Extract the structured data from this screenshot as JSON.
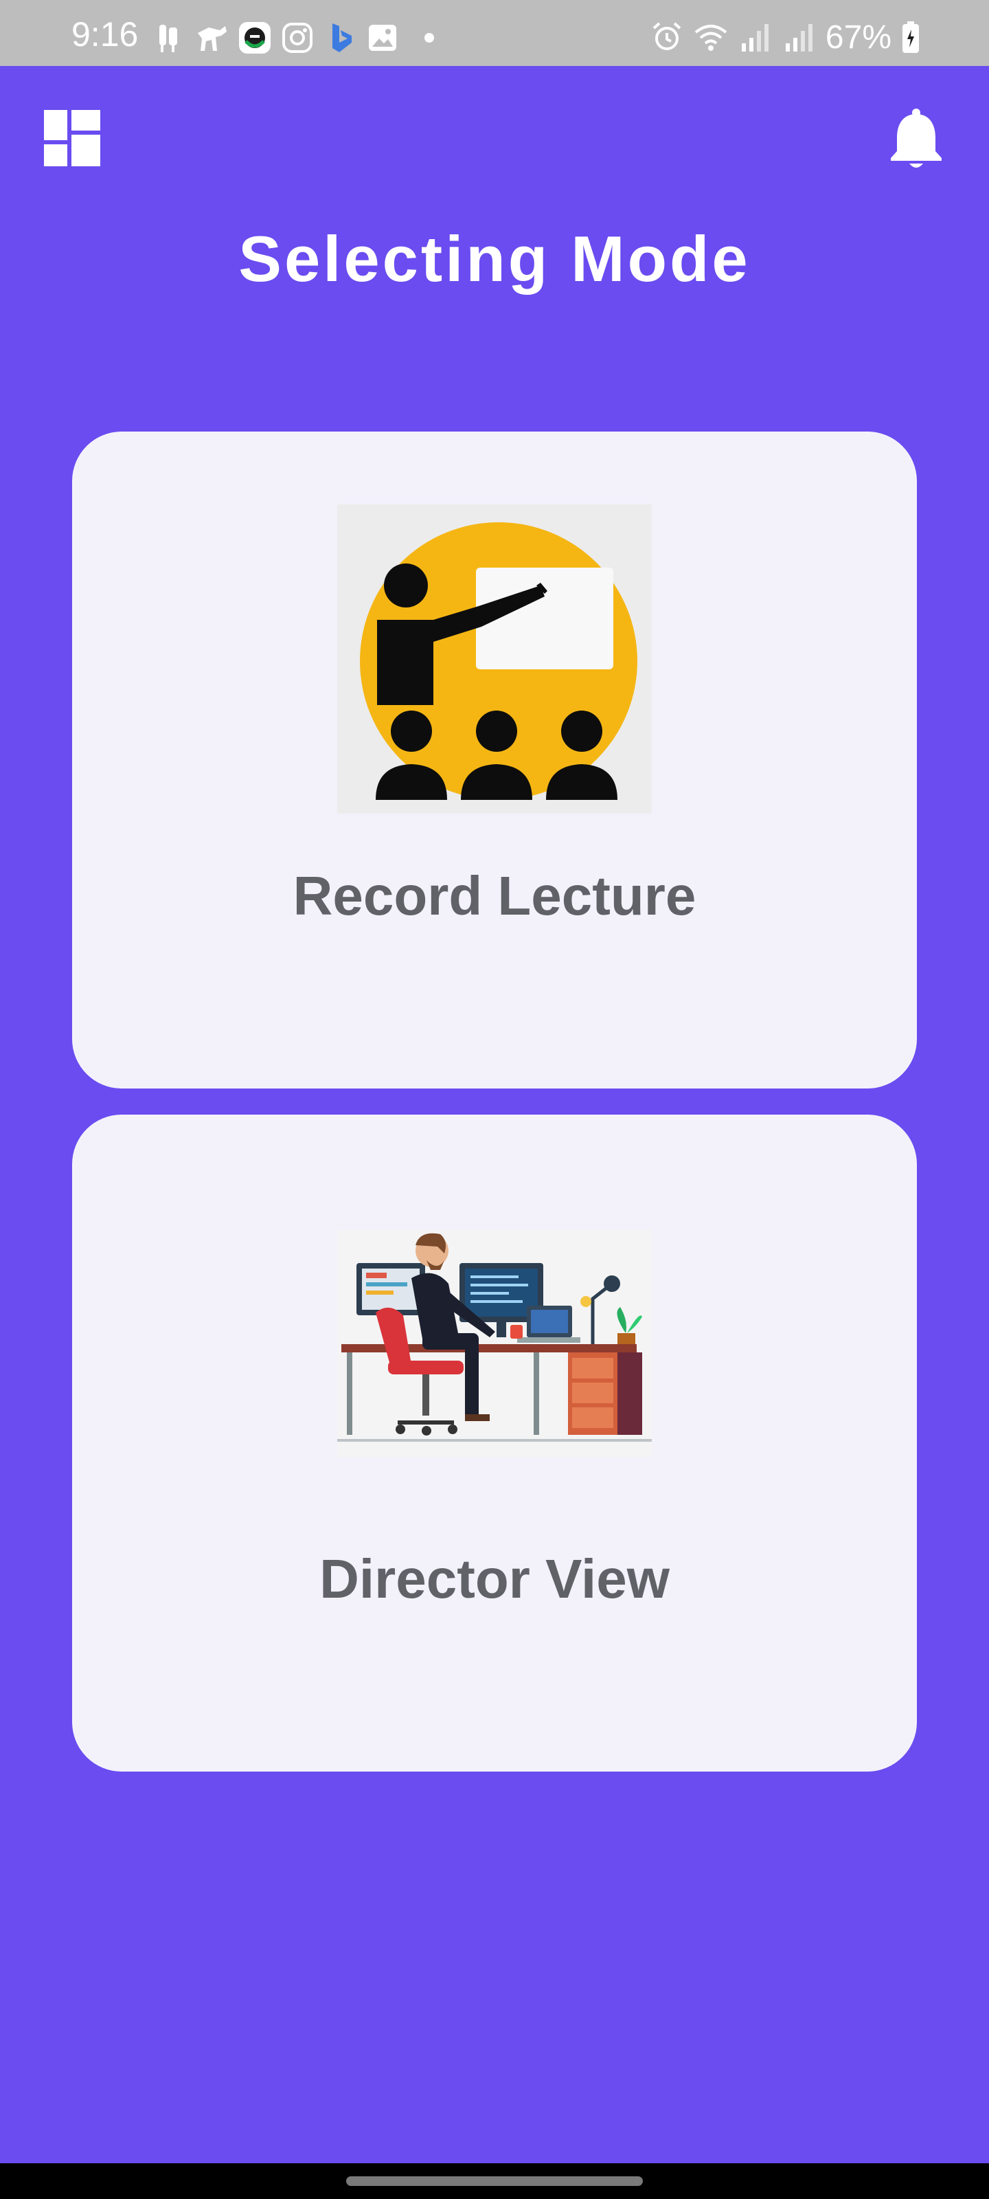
{
  "status_bar": {
    "time": "9:16",
    "battery": "67%",
    "left_icons": [
      "stroller-icon",
      "dog-walk-icon",
      "app-e-icon",
      "instagram-icon",
      "bing-icon",
      "gallery-icon"
    ],
    "right_icons": [
      "alarm-icon",
      "wifi-icon",
      "signal-icon",
      "signal-icon",
      "battery-icon"
    ]
  },
  "header": {
    "title": "Selecting Mode",
    "left_icon": "dashboard-icon",
    "right_icon": "bell-icon"
  },
  "modes": [
    {
      "label": "Record Lecture",
      "image": "lecture-illustration"
    },
    {
      "label": "Director View",
      "image": "director-illustration"
    }
  ],
  "colors": {
    "background": "#6a4cf0",
    "card": "#f3f2fb",
    "card_text": "#616168",
    "status_bar": "#bdbdbd",
    "lecture_circle": "#f5b614"
  }
}
